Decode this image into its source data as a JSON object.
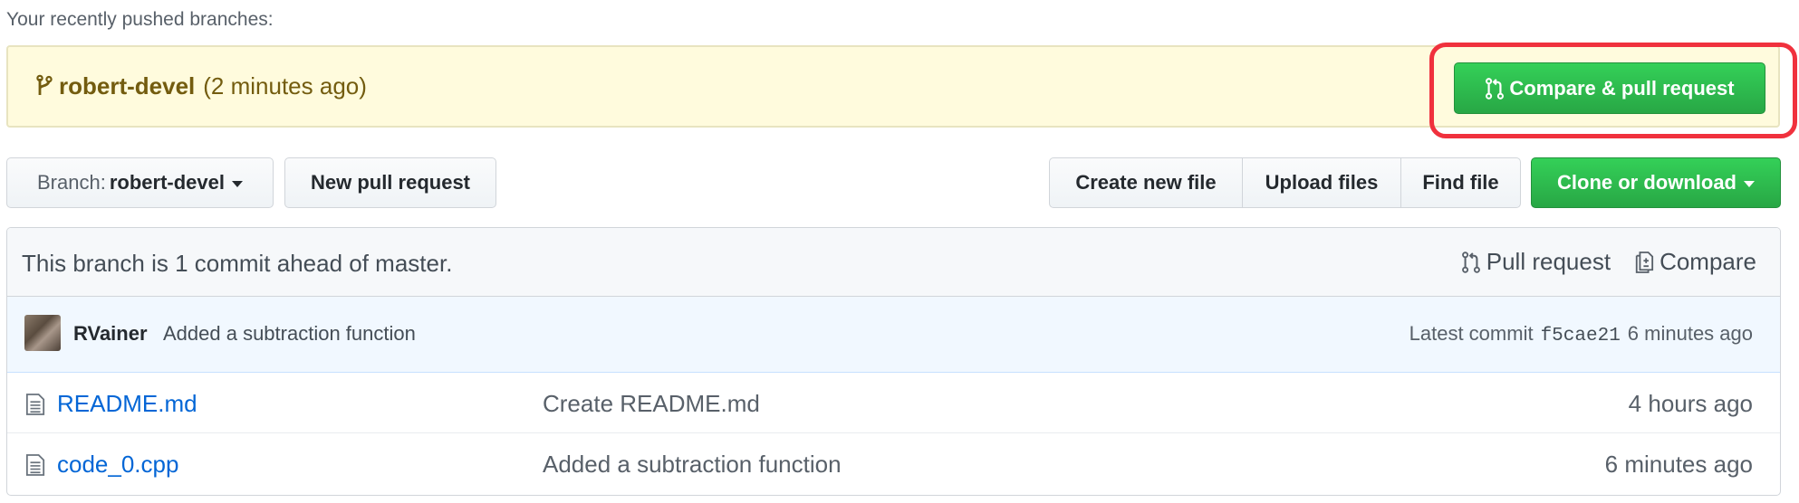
{
  "recent": {
    "label": "Your recently pushed branches:",
    "branch": "robert-devel",
    "age": "(2 minutes ago)",
    "compare_button": "Compare & pull request"
  },
  "toolbar": {
    "branch_label": "Branch:",
    "branch_value": "robert-devel",
    "new_pr": "New pull request",
    "create_file": "Create new file",
    "upload_files": "Upload files",
    "find_file": "Find file",
    "clone": "Clone or download"
  },
  "branch_status": {
    "text": "This branch is 1 commit ahead of master.",
    "pull_request": "Pull request",
    "compare": "Compare"
  },
  "latest_commit": {
    "author": "RVainer",
    "message": "Added a subtraction function",
    "prefix": "Latest commit",
    "sha": "f5cae21",
    "age": "6 minutes ago"
  },
  "files": [
    {
      "name": "README.md",
      "message": "Create README.md",
      "age": "4 hours ago"
    },
    {
      "name": "code_0.cpp",
      "message": "Added a subtraction function",
      "age": "6 minutes ago"
    }
  ],
  "colors": {
    "primary_green": "#28a745",
    "highlight_red": "#f0313d",
    "link_blue": "#0366d6",
    "notice_yellow": "#fffbdd"
  }
}
